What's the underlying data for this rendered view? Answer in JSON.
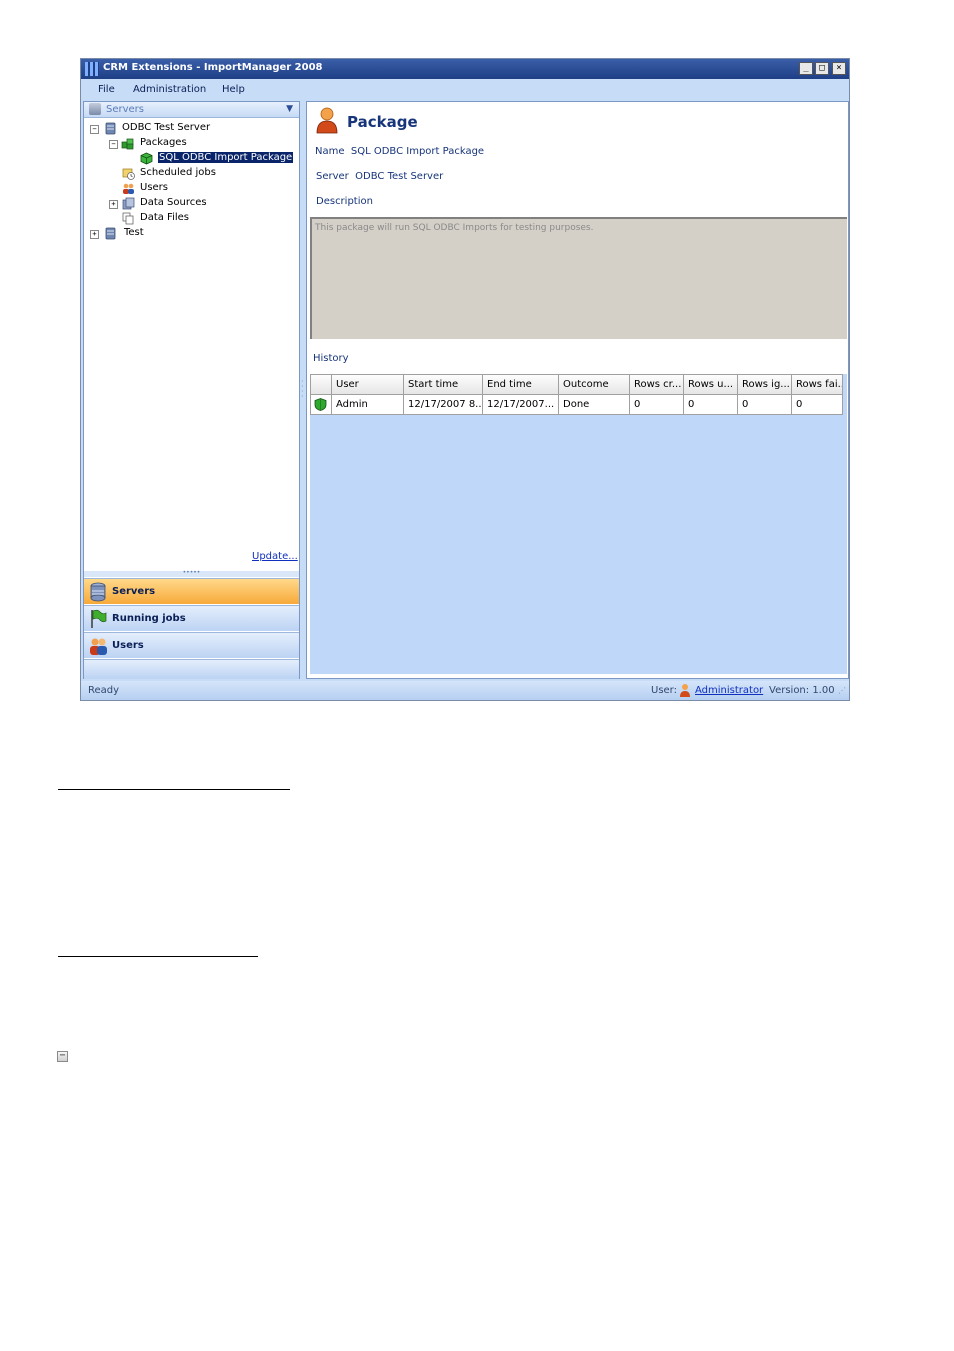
{
  "window": {
    "title": "CRM Extensions - ImportManager 2008",
    "controls": {
      "minimize": "_",
      "maximize": "□",
      "close": "×"
    }
  },
  "menu": [
    {
      "label": "File"
    },
    {
      "label": "Administration"
    },
    {
      "label": "Help"
    }
  ],
  "sidebar": {
    "header": "Servers",
    "tree": [
      {
        "label": "ODBC Test Server",
        "toggle": "−",
        "icon": "server-icon"
      },
      {
        "label": "Packages",
        "toggle": "−",
        "icon": "packages-icon"
      },
      {
        "label": "SQL ODBC Import Package",
        "icon": "package-icon",
        "selected": true
      },
      {
        "label": "Scheduled jobs",
        "icon": "scheduled-jobs-icon"
      },
      {
        "label": "Users",
        "icon": "users-icon"
      },
      {
        "label": "Data Sources",
        "toggle": "+",
        "icon": "data-sources-icon"
      },
      {
        "label": "Data Files",
        "icon": "data-files-icon"
      },
      {
        "label": "Test",
        "toggle": "+",
        "icon": "server-icon"
      }
    ],
    "update_link": "Update...",
    "nav": [
      {
        "label": "Servers",
        "icon": "servers-icon",
        "active": true
      },
      {
        "label": "Running jobs",
        "icon": "flag-icon"
      },
      {
        "label": "Users",
        "icon": "users-icon"
      }
    ]
  },
  "detail": {
    "title": "Package",
    "name_label": "Name",
    "name_value": "SQL ODBC Import Package",
    "server_label": "Server",
    "server_value": "ODBC Test Server",
    "description_label": "Description",
    "description_text": "This package will run SQL ODBC Imports for testing purposes.",
    "history_label": "History",
    "history_columns": [
      "User",
      "Start time",
      "End time",
      "Outcome",
      "Rows cr...",
      "Rows u...",
      "Rows ig...",
      "Rows fai..."
    ],
    "history_rows": [
      [
        "Admin",
        "12/17/2007 8...",
        "12/17/2007...",
        "Done",
        "0",
        "0",
        "0",
        "0"
      ]
    ]
  },
  "statusbar": {
    "status": "Ready",
    "user_label": "User:",
    "user_name": "Administrator",
    "version": "Version: 1.00"
  },
  "colors": {
    "accent": "#17357a",
    "title_bar": "#1e3f86",
    "nav_active": "#f7a93a",
    "grid_background": "#bfd7f9"
  }
}
